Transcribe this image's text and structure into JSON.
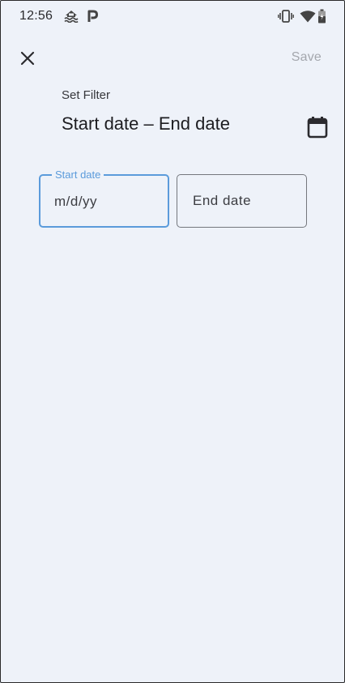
{
  "status_bar": {
    "time": "12:56",
    "left_icons": [
      "weather-icon",
      "parking-p-icon"
    ],
    "right_icons": [
      "vibrate-icon",
      "wifi-icon",
      "battery-icon"
    ]
  },
  "app_bar": {
    "close_icon": "close-icon",
    "save_label": "Save"
  },
  "header": {
    "overline": "Set Filter",
    "title": "Start date – End date",
    "calendar_icon": "calendar-icon"
  },
  "fields": {
    "start": {
      "label": "Start date",
      "placeholder": "m/d/yy"
    },
    "end": {
      "label": "End date"
    }
  },
  "colors": {
    "background": "#eef2f9",
    "accent": "#5b9bdb",
    "disabled_text": "#a4a7ad"
  }
}
